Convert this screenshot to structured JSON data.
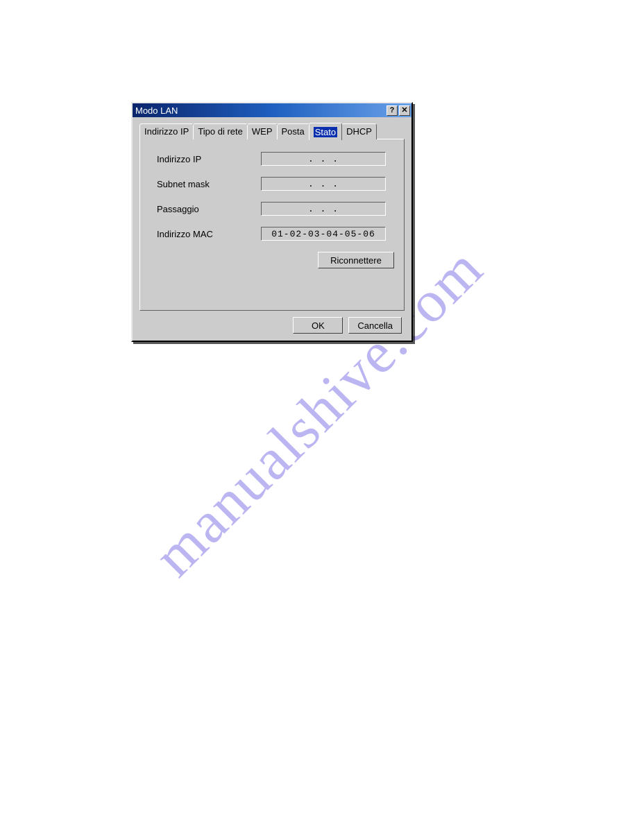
{
  "watermark": "manualshive.com",
  "dialog": {
    "title": "Modo LAN",
    "help_glyph": "?",
    "close_glyph": "✕"
  },
  "tabs": [
    {
      "label": "Indirizzo IP"
    },
    {
      "label": "Tipo di rete"
    },
    {
      "label": "WEP"
    },
    {
      "label": "Posta"
    },
    {
      "label": "Stato"
    },
    {
      "label": "DHCP"
    }
  ],
  "fields": {
    "ip": {
      "label": "Indirizzo IP",
      "value": ".   .   ."
    },
    "subnet": {
      "label": "Subnet mask",
      "value": ".   .   ."
    },
    "gateway": {
      "label": "Passaggio",
      "value": ".   .   ."
    },
    "mac": {
      "label": "Indirizzo MAC",
      "value": "01-02-03-04-05-06"
    }
  },
  "buttons": {
    "reconnect": "Riconnettere",
    "ok": "OK",
    "cancel": "Cancella"
  }
}
